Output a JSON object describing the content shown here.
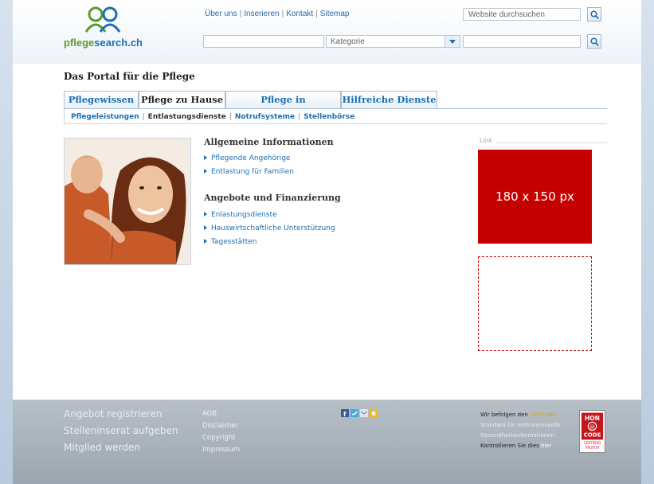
{
  "logo": {
    "name_part1": "pflege",
    "name_part2": "search",
    "tld": ".ch"
  },
  "top_links": [
    "Über uns",
    "Inserieren",
    "Kontakt",
    "Sitemap"
  ],
  "site_search": {
    "placeholder": "Website durchsuchen"
  },
  "category_search": {
    "value": "",
    "select_value": "Kategorie",
    "second_value": ""
  },
  "portal_title": "Das Portal für die Pflege",
  "tabs": [
    "Pflegewissen",
    "Pflege zu Hause",
    "Pflege in Institutionen",
    "Hilfreiche Dienste"
  ],
  "active_tab": "Pflege zu Hause",
  "subnav": [
    "Pflegeleistungen",
    "Entlastungsdienste",
    "Notrufsysteme",
    "Stellenbörse"
  ],
  "sections": [
    {
      "heading": "Allgemeine Informationen",
      "links": [
        "Pflegende Angehörige",
        "Entlastung für Familien"
      ]
    },
    {
      "heading": "Angebote und Finanzierung",
      "links": [
        "Enlastungsdienste",
        "Hauswirtschaftliche Unterstützung",
        "Tagesstätten"
      ]
    }
  ],
  "sidebar": {
    "caption": "Link",
    "ad_text": "180 x 150 px"
  },
  "footer": {
    "big_links": [
      "Angebot registrieren",
      "Stelleninserat aufgeben",
      "Mitglied werden"
    ],
    "small_links": [
      "AGB",
      "Disclaimer",
      "Copyright",
      "Impressum"
    ],
    "hon_lines": [
      {
        "text": "Wir befolgen den ",
        "hl": "HONcode"
      },
      {
        "text": "Standard für vertrauensvolle",
        "hl": ""
      },
      {
        "text": "Gesundheitsinformationen",
        "hl": "."
      },
      {
        "text": "Kontrollieren Sie dies ",
        "hl": "hier"
      }
    ],
    "hon_badge": {
      "line1": "HON",
      "line2": "CODE",
      "line3": "CERTIFIED",
      "line4": "08/2010"
    }
  },
  "colors": {
    "brand_blue": "#1b6fb4",
    "brand_green": "#5a9a2a",
    "ad_red": "#c40000",
    "footer_grey": "#a9b2bb"
  },
  "icons": [
    "search-icon",
    "dropdown-arrow-icon",
    "facebook-icon",
    "twitter-icon",
    "email-icon",
    "bookmark-star-icon",
    "hon-code-badge"
  ]
}
